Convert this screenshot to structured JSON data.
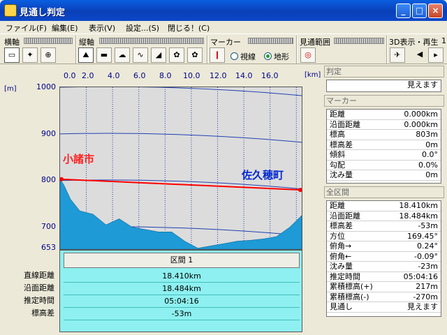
{
  "window": {
    "title": "見通し判定",
    "min": "_",
    "max": "□",
    "close": "×"
  },
  "menu": [
    "ファイル(F)",
    "編集(E)",
    "表示(V)",
    "設定...(S)",
    "閉じる！(C)"
  ],
  "toolbar": {
    "yokojiku": "横軸",
    "tatejiku": "縦軸",
    "marker": "マーカー",
    "range": "見通範囲",
    "display3d": "3D表示・再生",
    "display3d_extra": "1",
    "radio_line": "視線",
    "radio_terrain": "地形"
  },
  "axis": {
    "unit_left": "[m]",
    "unit_right": "[km]",
    "x_ticks": [
      "0.0",
      "2.0",
      "4.0",
      "6.0",
      "8.0",
      "10.0",
      "12.0",
      "14.0",
      "16.0"
    ],
    "y_ticks": [
      "1000",
      "900",
      "800",
      "700",
      "653"
    ]
  },
  "chart_data": {
    "type": "area",
    "xlabel": "",
    "ylabel": "",
    "x_unit": "km",
    "y_unit": "m",
    "xlim": [
      0,
      18.41
    ],
    "ylim": [
      653,
      1000
    ],
    "x": [
      0,
      0.3,
      0.8,
      1.5,
      2.5,
      3.5,
      4.5,
      5.5,
      6.5,
      7.5,
      8.5,
      9.5,
      10.5,
      11.5,
      12.5,
      13.5,
      14.5,
      15.5,
      16.5,
      17.5,
      18.41
    ],
    "y": [
      803,
      790,
      760,
      735,
      728,
      705,
      718,
      700,
      695,
      690,
      690,
      670,
      655,
      660,
      665,
      670,
      672,
      675,
      680,
      700,
      725
    ],
    "sightline": {
      "from": [
        0,
        803
      ],
      "to": [
        18.41,
        780
      ]
    },
    "labels": {
      "start": "小諸市",
      "end": "佐久穂町"
    }
  },
  "section": {
    "header": "区間 1",
    "labels": [
      "直線距離",
      "沿面距離",
      "推定時間",
      "標高差"
    ],
    "values": [
      "18.410km",
      "18.484km",
      "05:04:16",
      "-53m"
    ]
  },
  "panel": {
    "judge_title": "判定",
    "judge_value": "見えます",
    "marker_title": "マーカー",
    "marker_rows": [
      [
        "距離",
        "0.000km"
      ],
      [
        "沿面距離",
        "0.000km"
      ],
      [
        "標高",
        "803m"
      ],
      [
        "標高差",
        "0m"
      ],
      [
        "傾斜",
        "0.0°"
      ],
      [
        "勾配",
        "0.0%"
      ],
      [
        "沈み量",
        "0m"
      ]
    ],
    "all_title": "全区間",
    "all_rows": [
      [
        "距離",
        "18.410km"
      ],
      [
        "沿面距離",
        "18.484km"
      ],
      [
        "標高差",
        "-53m"
      ],
      [
        "方位",
        "169.45°"
      ],
      [
        "俯角→",
        "0.24°"
      ],
      [
        "俯角←",
        "-0.09°"
      ],
      [
        "沈み量",
        "-23m"
      ],
      [
        "推定時間",
        "05:04:16"
      ],
      [
        "累積標高(+)",
        "217m"
      ],
      [
        "累積標高(-)",
        "-270m"
      ],
      [
        "見通し",
        "見えます"
      ]
    ]
  },
  "colors": {
    "terrain": "#1e9ad6",
    "sightline": "#ff0000",
    "grid": "#2040b0",
    "sky": "#dcdcdc",
    "city": "#ff2020",
    "city2": "#0028d0"
  }
}
